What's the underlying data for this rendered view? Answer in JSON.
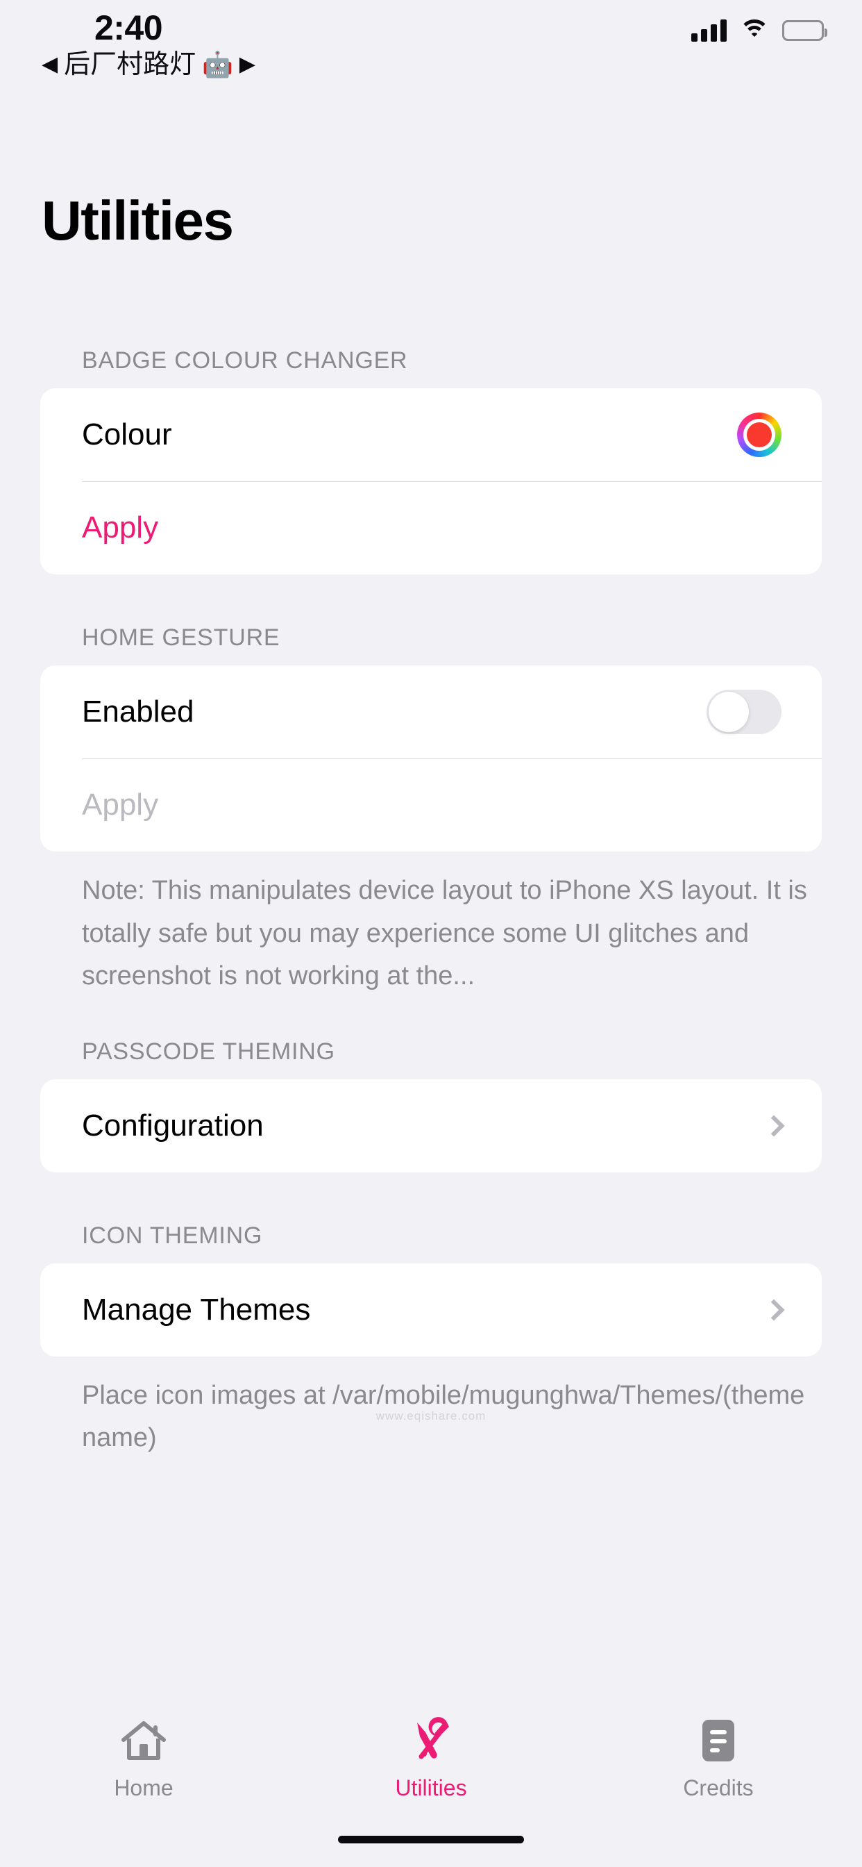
{
  "status_bar": {
    "time": "2:40",
    "carrier_left_arrow": "◀",
    "carrier_name": "后厂村路灯",
    "carrier_emoji": "🤖",
    "carrier_right_arrow": "▶",
    "signal_icon": "cellular-signal-icon",
    "wifi_icon": "wifi-icon",
    "battery_icon": "battery-icon"
  },
  "page": {
    "title": "Utilities"
  },
  "sections": {
    "badge_colour": {
      "header": "BADGE COLOUR CHANGER",
      "colour_label": "Colour",
      "colour_value_hex": "#f9392e",
      "apply_label": "Apply",
      "apply_color_hex": "#ec1b74"
    },
    "home_gesture": {
      "header": "HOME GESTURE",
      "enabled_label": "Enabled",
      "enabled_value": "off",
      "apply_label": "Apply",
      "note": "Note: This manipulates device layout to iPhone XS layout. It is totally safe but you may experience some UI glitches and screenshot is not working at the..."
    },
    "passcode_theming": {
      "header": "PASSCODE THEMING",
      "configuration_label": "Configuration"
    },
    "icon_theming": {
      "header": "ICON THEMING",
      "manage_themes_label": "Manage Themes",
      "note": "Place icon images at /var/mobile/mugunghwa/Themes/(theme name)"
    }
  },
  "watermark": "www.eqishare.com",
  "tabbar": {
    "items": [
      {
        "label": "Home",
        "icon": "house-icon",
        "active": false
      },
      {
        "label": "Utilities",
        "icon": "tools-icon",
        "active": true
      },
      {
        "label": "Credits",
        "icon": "document-icon",
        "active": false
      }
    ],
    "active_color_hex": "#ec1b74",
    "inactive_color_hex": "#8a8a8e"
  }
}
